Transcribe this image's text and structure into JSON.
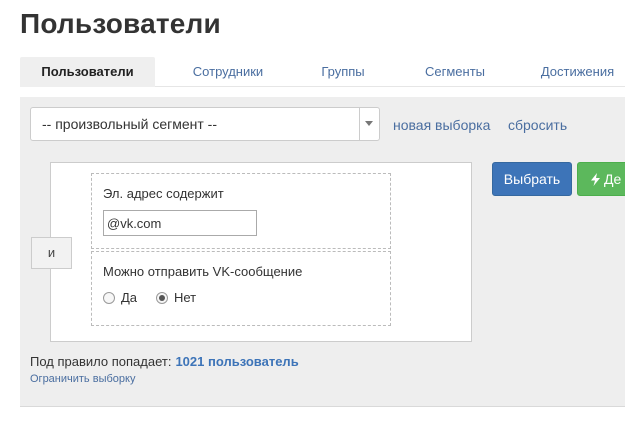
{
  "page": {
    "title": "Пользователи"
  },
  "tabs": [
    {
      "label": "Пользователи",
      "active": true
    },
    {
      "label": "Сотрудники",
      "active": false
    },
    {
      "label": "Группы",
      "active": false
    },
    {
      "label": "Сегменты",
      "active": false
    },
    {
      "label": "Достижения",
      "active": false
    }
  ],
  "filter": {
    "segment_select": {
      "value": "-- произвольный сегмент --",
      "icon": "caret-down-icon"
    },
    "new_selection_link": "новая выборка",
    "reset_link": "сбросить",
    "combinator_label": "и",
    "conditions": [
      {
        "label": "Эл. адрес содержит",
        "input_value": "@vk.com"
      },
      {
        "label": "Можно отправить VK-сообщение",
        "options": [
          {
            "label": "Да",
            "checked": false
          },
          {
            "label": "Нет",
            "checked": true
          }
        ]
      }
    ]
  },
  "actions": {
    "select_label": "Выбрать",
    "second_label": "Де",
    "second_icon": "lightning-bolt-icon"
  },
  "summary": {
    "prefix": "Под правило попадает:",
    "count": "1021 пользователь",
    "limit_link": "Ограничить выборку"
  },
  "colors": {
    "primary": "#3d74b8",
    "success": "#5cb85c",
    "link": "#4a6ea0",
    "panel_bg": "#eeeeee"
  }
}
